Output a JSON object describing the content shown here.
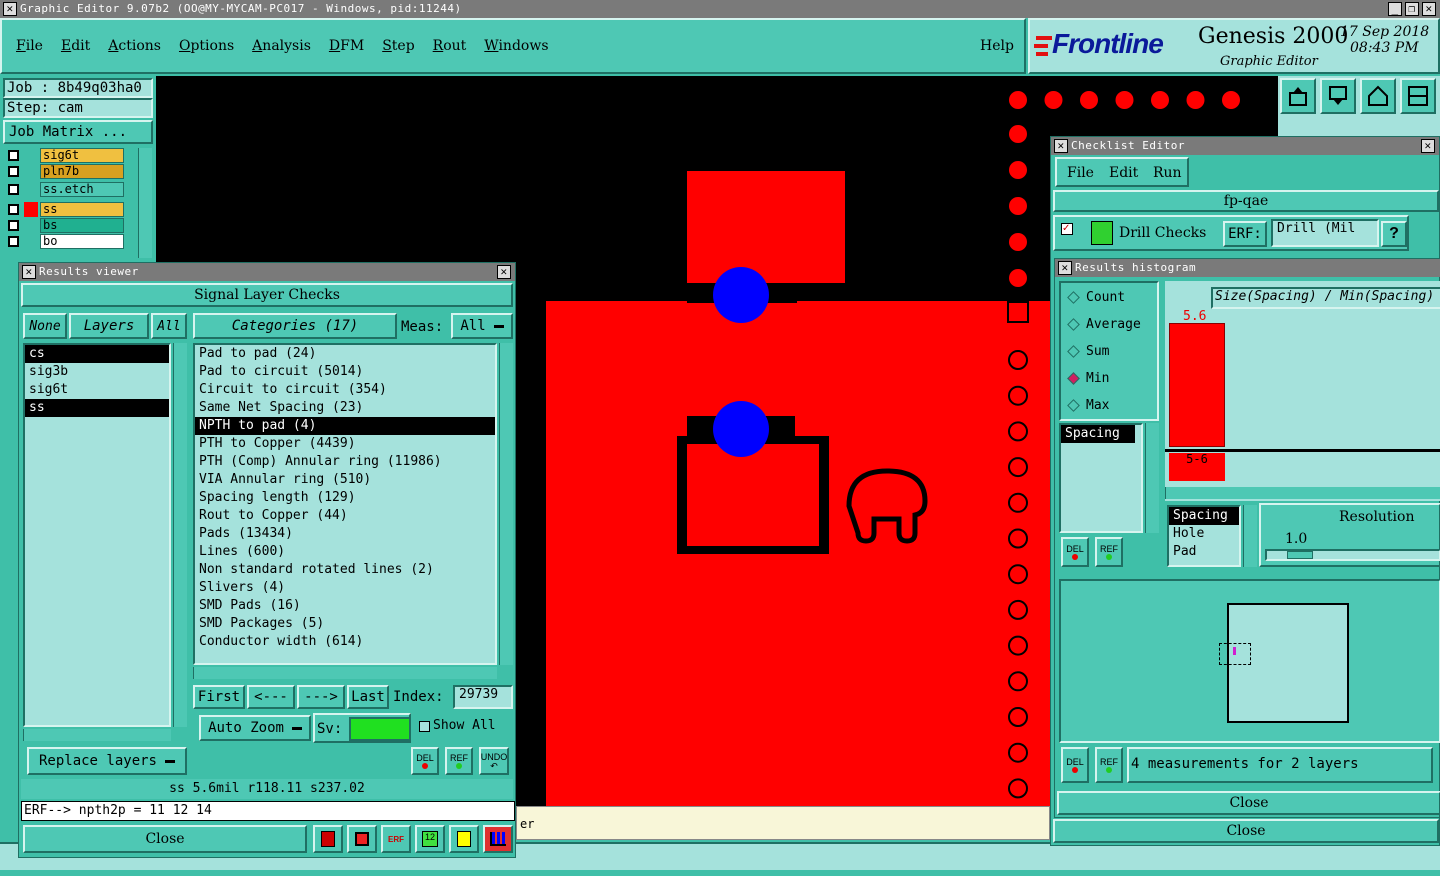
{
  "app": {
    "title": "Graphic Editor 9.07b2 (OO@MY-MYCAM-PC017 - Windows, pid:11244)",
    "win_buttons": [
      "_",
      "❐",
      "✕"
    ]
  },
  "menu": [
    "File",
    "Edit",
    "Actions",
    "Options",
    "Analysis",
    "DFM",
    "Step",
    "Rout",
    "Windows"
  ],
  "help": "Help",
  "brand": {
    "logo": "Frontline",
    "product": "Genesis 2000",
    "sub": "Graphic Editor",
    "date": "17 Sep 2018",
    "time": "08:43 PM"
  },
  "job": {
    "job": "Job : 8b49q03ha0",
    "step": "Step: cam",
    "matrix_btn": "Job Matrix ..."
  },
  "layers": [
    {
      "name": "sig6t",
      "color": "#f0c040"
    },
    {
      "name": "pln7b",
      "color": "#d8a020"
    },
    {
      "name": "ss.etch",
      "color": "#4ec8b4"
    },
    {
      "name": "ss",
      "color": "#f0c040"
    },
    {
      "name": "bs",
      "color": "#20b090"
    },
    {
      "name": "bo",
      "color": "#ffffff"
    }
  ],
  "results": {
    "title": "Results viewer",
    "section": "Signal Layer Checks",
    "none": "None",
    "layers_label": "Layers",
    "all": "All",
    "categories": "Categories (17)",
    "meas_label": "Meas:",
    "meas_value": "All",
    "layer_list": [
      {
        "n": "cs",
        "s": true
      },
      {
        "n": "sig3b",
        "s": false
      },
      {
        "n": "sig6t",
        "s": false
      },
      {
        "n": "ss",
        "s": true
      }
    ],
    "category_list": [
      {
        "n": "Pad to pad (24)",
        "s": false
      },
      {
        "n": "Pad to circuit (5014)",
        "s": false
      },
      {
        "n": "Circuit to circuit (354)",
        "s": false
      },
      {
        "n": "Same Net Spacing (23)",
        "s": false
      },
      {
        "n": "NPTH to pad (4)",
        "s": true
      },
      {
        "n": "PTH to Copper (4439)",
        "s": false
      },
      {
        "n": "PTH (Comp) Annular ring (11986)",
        "s": false
      },
      {
        "n": "VIA Annular ring (510)",
        "s": false
      },
      {
        "n": "Spacing length (129)",
        "s": false
      },
      {
        "n": "Rout to Copper (44)",
        "s": false
      },
      {
        "n": "Pads (13434)",
        "s": false
      },
      {
        "n": "Lines (600)",
        "s": false
      },
      {
        "n": "Non standard rotated lines (2)",
        "s": false
      },
      {
        "n": "Slivers (4)",
        "s": false
      },
      {
        "n": "SMD Pads (16)",
        "s": false
      },
      {
        "n": "SMD Packages (5)",
        "s": false
      },
      {
        "n": "Conductor width (614)",
        "s": false
      }
    ],
    "first": "First",
    "prev": "<---",
    "next": "--->",
    "last": "Last",
    "index_label": "Index:",
    "index_value": "29739",
    "auto_zoom": "Auto Zoom",
    "sv_label": "Sv:",
    "show_all": "Show All",
    "replace": "Replace layers",
    "del": "DEL",
    "ref": "REF",
    "undo": "UNDO",
    "status": "ss 5.6mil  r118.11  s237.02",
    "erf": "ERF--> npth2p = 11 12 14",
    "close": "Close"
  },
  "checklist": {
    "title": "Checklist Editor",
    "menu": [
      "File",
      "Edit",
      "Run"
    ],
    "name": "fp-qae",
    "check_name": "Drill Checks",
    "erf_label": "ERF:",
    "erf_value": "Drill (Mil",
    "help": "?",
    "close": "Close"
  },
  "histogram": {
    "title": "Results histogram",
    "options": [
      {
        "n": "Count",
        "s": false
      },
      {
        "n": "Average",
        "s": false
      },
      {
        "n": "Sum",
        "s": false
      },
      {
        "n": "Min",
        "s": true
      },
      {
        "n": "Max",
        "s": false
      }
    ],
    "heading": "Size(Spacing) / Min(Spacing)",
    "bar_value": "5.6",
    "bar_fraction": 0.95,
    "bin_label": "5-6",
    "list1": [
      "Spacing"
    ],
    "list2": [
      "Spacing",
      "Hole",
      "Pad"
    ],
    "resolution_label": "Resolution",
    "resolution_value": "1.0",
    "del": "DEL",
    "ref": "REF",
    "info": "4 measurements for 2 layers",
    "close": "Close"
  },
  "partial_text": "er",
  "colors": {
    "teal": "#4ec8b4",
    "copper": "#ff0000",
    "pad": "#0000ff"
  }
}
